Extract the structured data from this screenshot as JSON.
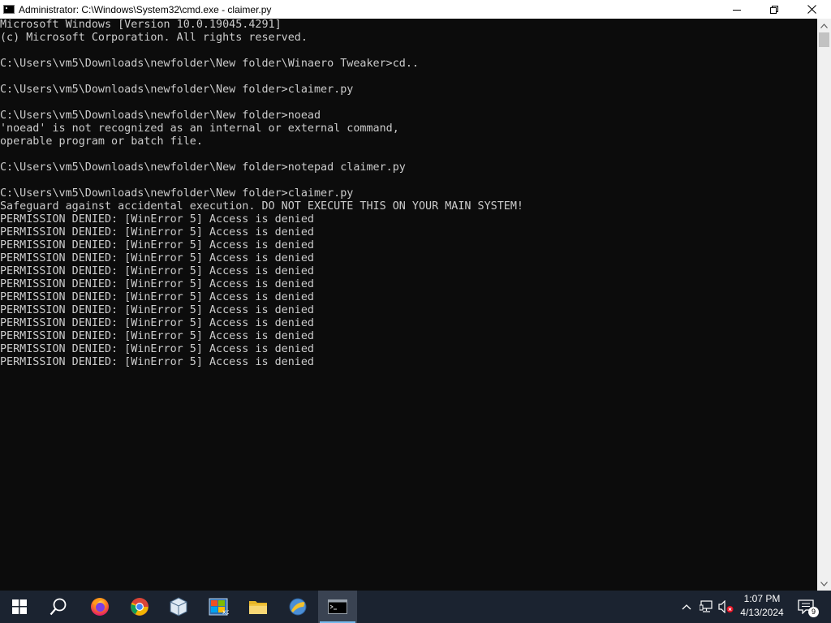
{
  "window": {
    "title": "Administrator: C:\\Windows\\System32\\cmd.exe - claimer.py"
  },
  "console": {
    "lines": [
      "Microsoft Windows [Version 10.0.19045.4291]",
      "(c) Microsoft Corporation. All rights reserved.",
      "",
      "C:\\Users\\vm5\\Downloads\\newfolder\\New folder\\Winaero Tweaker>cd..",
      "",
      "C:\\Users\\vm5\\Downloads\\newfolder\\New folder>claimer.py",
      "",
      "C:\\Users\\vm5\\Downloads\\newfolder\\New folder>noead",
      "'noead' is not recognized as an internal or external command,",
      "operable program or batch file.",
      "",
      "C:\\Users\\vm5\\Downloads\\newfolder\\New folder>notepad claimer.py",
      "",
      "C:\\Users\\vm5\\Downloads\\newfolder\\New folder>claimer.py",
      "Safeguard against accidental execution. DO NOT EXECUTE THIS ON YOUR MAIN SYSTEM!",
      "PERMISSION DENIED: [WinError 5] Access is denied",
      "PERMISSION DENIED: [WinError 5] Access is denied",
      "PERMISSION DENIED: [WinError 5] Access is denied",
      "PERMISSION DENIED: [WinError 5] Access is denied",
      "PERMISSION DENIED: [WinError 5] Access is denied",
      "PERMISSION DENIED: [WinError 5] Access is denied",
      "PERMISSION DENIED: [WinError 5] Access is denied",
      "PERMISSION DENIED: [WinError 5] Access is denied",
      "PERMISSION DENIED: [WinError 5] Access is denied",
      "PERMISSION DENIED: [WinError 5] Access is denied",
      "PERMISSION DENIED: [WinError 5] Access is denied",
      "PERMISSION DENIED: [WinError 5] Access is denied"
    ],
    "text_color": "#cccccc",
    "background": "#0c0c0c"
  },
  "taskbar": {
    "items": [
      {
        "icon": "windows-start-icon",
        "active": false
      },
      {
        "icon": "search-icon",
        "active": false
      },
      {
        "icon": "firefox-icon",
        "active": false
      },
      {
        "icon": "chrome-icon",
        "active": false
      },
      {
        "icon": "virtualbox-cube-icon",
        "active": false
      },
      {
        "icon": "xp-tweaker-icon",
        "active": false
      },
      {
        "icon": "file-explorer-icon",
        "active": false
      },
      {
        "icon": "winaero-tweaker-icon",
        "active": false
      },
      {
        "icon": "command-prompt-icon",
        "active": true
      }
    ],
    "tray": {
      "icons": [
        "chevron-up-icon",
        "network-icon",
        "volume-muted-icon"
      ],
      "time": "1:07 PM",
      "date": "4/13/2024",
      "notification_count": "9"
    }
  },
  "colors": {
    "taskbar_bg": "#1b2330",
    "accent": "#76b9ed"
  }
}
